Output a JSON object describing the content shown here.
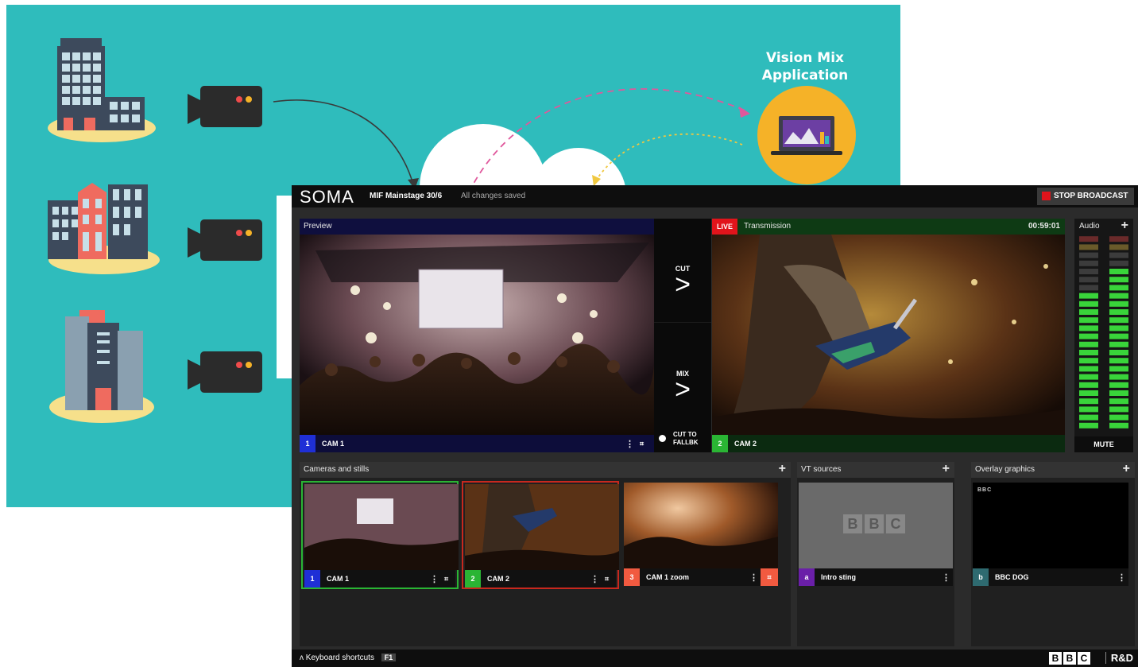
{
  "diagram": {
    "title": "Vision Mix Application",
    "colors": {
      "background": "#2fbcbc",
      "pink_arrow": "#e0589c",
      "yellow_arrow": "#f0c840",
      "circle": "#f5b228",
      "camera": "#2b2b2b"
    }
  },
  "app": {
    "logo": "SOMA",
    "project_name": "MIF Mainstage 30/6",
    "save_status": "All changes saved",
    "stop_broadcast_label": "STOP BROADCAST",
    "preview": {
      "title": "Preview",
      "cam_number": "1",
      "cam_label": "CAM 1"
    },
    "switcher": {
      "cut_label": "CUT",
      "mix_label": "MIX",
      "fallback_label": "CUT TO FALLBK"
    },
    "transmission": {
      "live_label": "LIVE",
      "title": "Transmission",
      "timecode": "00:59:01",
      "cam_number": "2",
      "cam_label": "CAM 2"
    },
    "audio": {
      "title": "Audio",
      "mute_label": "MUTE",
      "levels": [
        0.7,
        0.82
      ]
    },
    "cameras_section": {
      "title": "Cameras and stills",
      "items": [
        {
          "num": "1",
          "label": "CAM 1",
          "color": "#1f2fd6"
        },
        {
          "num": "2",
          "label": "CAM 2",
          "color": "#2ab534"
        },
        {
          "num": "3",
          "label": "CAM 1 zoom",
          "color": "#f15a40"
        }
      ]
    },
    "vt_section": {
      "title": "VT sources",
      "item": {
        "num": "a",
        "label": "Intro sting",
        "color": "#6a1fa8",
        "logo_letters": [
          "B",
          "B",
          "C"
        ]
      }
    },
    "overlay_section": {
      "title": "Overlay graphics",
      "item": {
        "num": "b",
        "label": "BBC DOG",
        "color": "#2e6a70",
        "preview_text": "BBC"
      }
    },
    "keyboard_shortcuts": {
      "label": "Keyboard shortcuts",
      "key": "F1"
    },
    "footer": {
      "bbc_letters": [
        "B",
        "B",
        "C"
      ],
      "rd": "R&D"
    }
  },
  "icons": {
    "plus": "+",
    "more": "⋮",
    "chevron": "ʌ"
  }
}
